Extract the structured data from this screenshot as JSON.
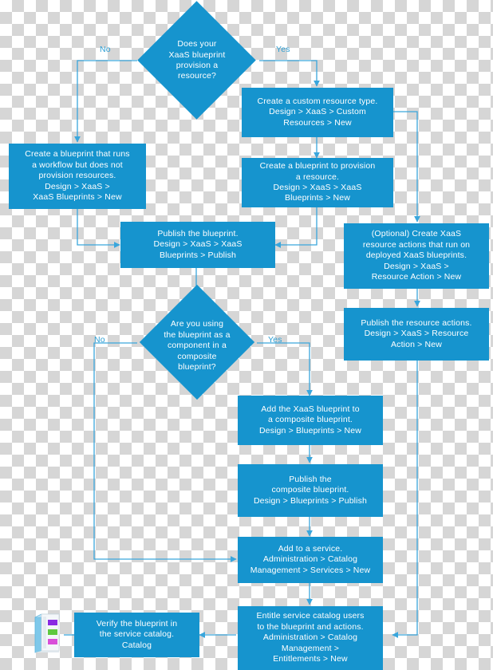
{
  "diagram": {
    "title": "XaaS blueprint publishing workflow",
    "accent_color": "#1694ce",
    "connector_color": "#3aa6dc",
    "text_color": "#ffffff",
    "background": "transparent-checkerboard"
  },
  "decisions": [
    {
      "id": "d1",
      "text": "Does your\nXaaS blueprint\nprovision a\nresource?",
      "branch_no": "No",
      "branch_yes": "Yes"
    },
    {
      "id": "d2",
      "text": "Are you using\nthe blueprint as a\ncomponent in a\ncomposite\nblueprint?",
      "branch_no": "No",
      "branch_yes": "Yes"
    }
  ],
  "steps": [
    {
      "id": "s_workflow_blueprint",
      "text": "Create a blueprint that runs\na workflow but does not\nprovision resources.\nDesign > XaaS >\nXaaS Blueprints > New"
    },
    {
      "id": "s_custom_resource",
      "text": "Create a custom resource type.\nDesign > XaaS > Custom\nResources > New"
    },
    {
      "id": "s_provision_blueprint",
      "text": "Create a blueprint to provision\na resource.\nDesign > XaaS > XaaS\nBlueprints > New"
    },
    {
      "id": "s_publish_blueprint",
      "text": "Publish the blueprint.\nDesign > XaaS > XaaS\nBlueprints > Publish"
    },
    {
      "id": "s_resource_action",
      "text": "(Optional) Create XaaS\nresource actions that run on\ndeployed XaaS blueprints.\nDesign > XaaS >\nResource Action > New"
    },
    {
      "id": "s_publish_action",
      "text": "Publish the resource actions.\nDesign > XaaS > Resource\nAction > New"
    },
    {
      "id": "s_add_composite",
      "text": "Add the XaaS blueprint to\na composite blueprint.\nDesign > Blueprints > New"
    },
    {
      "id": "s_publish_composite",
      "text": "Publish the\ncomposite blueprint.\nDesign > Blueprints > Publish"
    },
    {
      "id": "s_add_service",
      "text": "Add to a service.\nAdministration > Catalog\nManagement > Services > New"
    },
    {
      "id": "s_entitle",
      "text": "Entitle service catalog users\nto the blueprint and actions.\nAdministration > Catalog\nManagement >\nEntitlements > New"
    },
    {
      "id": "s_verify",
      "text": "Verify the blueprint in\nthe service catalog.\nCatalog"
    }
  ],
  "icon": {
    "name": "service-catalog-server-icon",
    "bar_colors": [
      "#8a2be2",
      "#5fc93f",
      "#d94fd9"
    ],
    "body_color": "#f4f7fa",
    "side_color": "#6fc4e8"
  }
}
